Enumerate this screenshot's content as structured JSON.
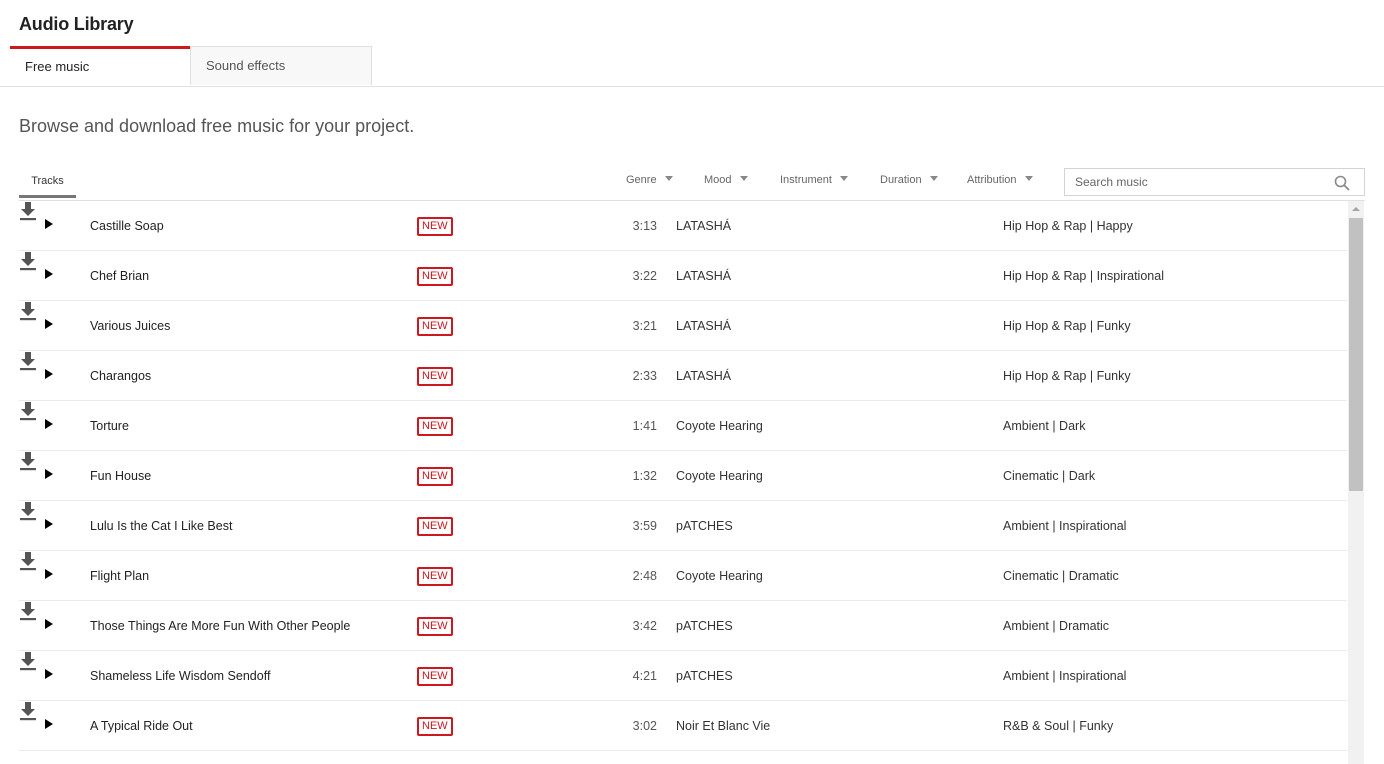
{
  "app": {
    "title": "Audio Library"
  },
  "tabs": [
    {
      "label": "Free music",
      "active": true
    },
    {
      "label": "Sound effects",
      "active": false
    }
  ],
  "subtitle": "Browse and download free music for your project.",
  "subtabs": {
    "tracks_label": "Tracks"
  },
  "filters": [
    {
      "label": "Genre"
    },
    {
      "label": "Mood"
    },
    {
      "label": "Instrument"
    },
    {
      "label": "Duration"
    },
    {
      "label": "Attribution"
    }
  ],
  "search": {
    "placeholder": "Search music",
    "value": "",
    "icon": "search-icon"
  },
  "colors": {
    "accent": "#cc181e",
    "badge": "#cc181e"
  },
  "tracks": [
    {
      "title": "Castille Soap",
      "badge": "NEW",
      "duration": "3:13",
      "artist": "LATASHÁ",
      "genre_mood": "Hip Hop & Rap | Happy"
    },
    {
      "title": "Chef Brian",
      "badge": "NEW",
      "duration": "3:22",
      "artist": "LATASHÁ",
      "genre_mood": "Hip Hop & Rap | Inspirational"
    },
    {
      "title": "Various Juices",
      "badge": "NEW",
      "duration": "3:21",
      "artist": "LATASHÁ",
      "genre_mood": "Hip Hop & Rap | Funky"
    },
    {
      "title": "Charangos",
      "badge": "NEW",
      "duration": "2:33",
      "artist": "LATASHÁ",
      "genre_mood": "Hip Hop & Rap | Funky"
    },
    {
      "title": "Torture",
      "badge": "NEW",
      "duration": "1:41",
      "artist": "Coyote Hearing",
      "genre_mood": "Ambient | Dark"
    },
    {
      "title": "Fun House",
      "badge": "NEW",
      "duration": "1:32",
      "artist": "Coyote Hearing",
      "genre_mood": "Cinematic | Dark"
    },
    {
      "title": "Lulu Is the Cat I Like Best",
      "badge": "NEW",
      "duration": "3:59",
      "artist": "pATCHES",
      "genre_mood": "Ambient | Inspirational"
    },
    {
      "title": "Flight Plan",
      "badge": "NEW",
      "duration": "2:48",
      "artist": "Coyote Hearing",
      "genre_mood": "Cinematic | Dramatic"
    },
    {
      "title": "Those Things Are More Fun With Other People",
      "badge": "NEW",
      "duration": "3:42",
      "artist": "pATCHES",
      "genre_mood": "Ambient | Dramatic"
    },
    {
      "title": "Shameless Life Wisdom Sendoff",
      "badge": "NEW",
      "duration": "4:21",
      "artist": "pATCHES",
      "genre_mood": "Ambient | Inspirational"
    },
    {
      "title": "A Typical Ride Out",
      "badge": "NEW",
      "duration": "3:02",
      "artist": "Noir Et Blanc Vie",
      "genre_mood": "R&B & Soul | Funky"
    }
  ]
}
